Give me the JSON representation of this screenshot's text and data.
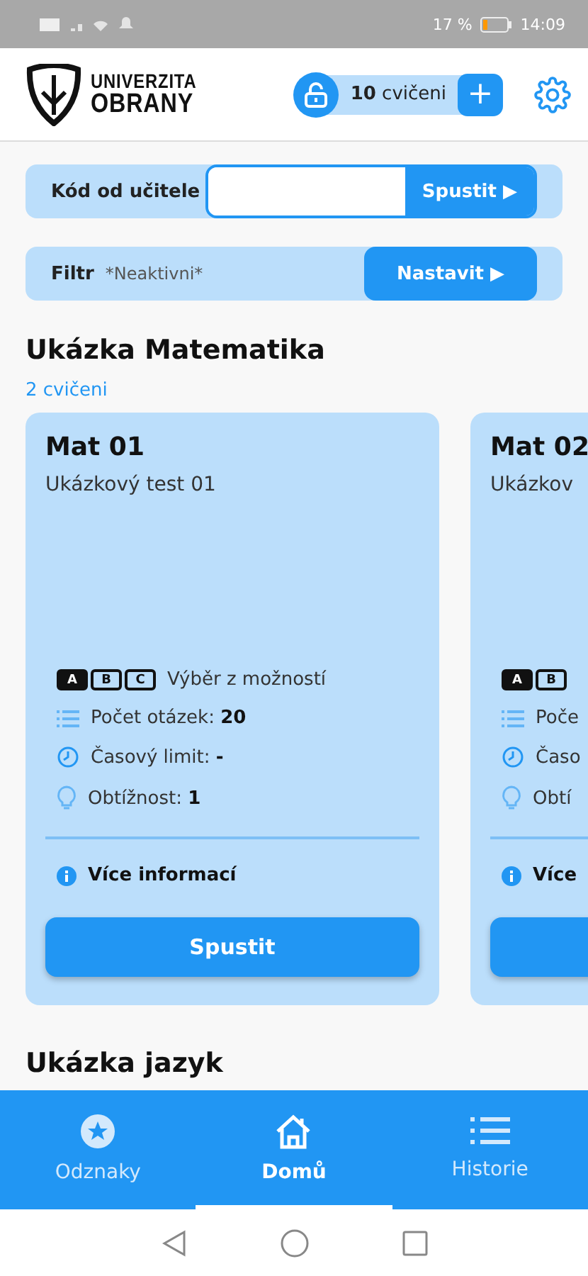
{
  "status_bar": {
    "battery": "17 %",
    "time": "14:09"
  },
  "header": {
    "logo_line1": "UNIVERZITA",
    "logo_line2": "OBRANY",
    "credits_count": "10",
    "credits_label": "cvičeni",
    "add_label": "+"
  },
  "code_panel": {
    "label": "Kód od učitele",
    "button": "Spustit ▶"
  },
  "filter_panel": {
    "label": "Filtr",
    "value": "*Neaktivni*",
    "button": "Nastavit ▶"
  },
  "sections": [
    {
      "title": "Ukázka Matematika",
      "count": "2 cvičeni",
      "cards": [
        {
          "title": "Mat 01",
          "subtitle": "Ukázkový test 01",
          "letters": [
            "A",
            "B",
            "C"
          ],
          "type": "Výběr z možností",
          "questions_label": "Počet otázek:",
          "questions": "20",
          "time_label": "Časový limit:",
          "time": "-",
          "difficulty_label": "Obtížnost:",
          "difficulty": "1",
          "info": "Více informací",
          "button": "Spustit"
        },
        {
          "title": "Mat 02",
          "subtitle": "Ukázkov",
          "letters": [
            "A",
            "B"
          ],
          "questions_label": "Poče",
          "time_label": "Časo",
          "difficulty_label": "Obtí",
          "info": "Více"
        }
      ]
    },
    {
      "title": "Ukázka jazyk"
    }
  ],
  "bottom_nav": [
    {
      "label": "Odznaky",
      "kind": "badges",
      "selected": false
    },
    {
      "label": "Domů",
      "kind": "home",
      "selected": true
    },
    {
      "label": "Historie",
      "kind": "history",
      "selected": false
    }
  ]
}
